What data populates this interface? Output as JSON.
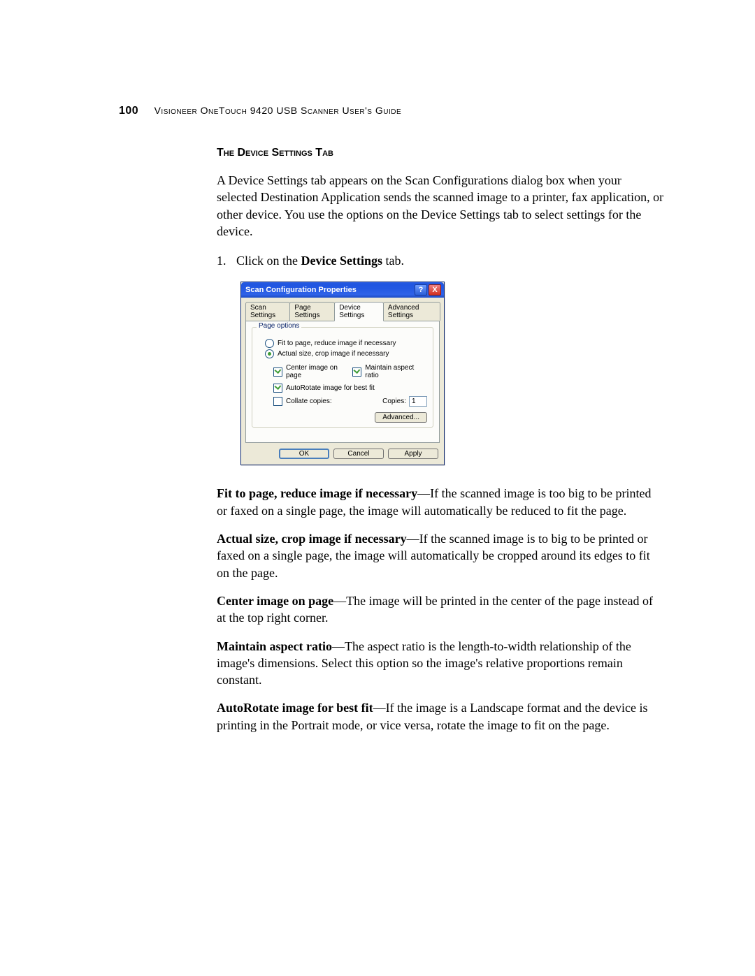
{
  "header": {
    "page_number": "100",
    "title": "Visioneer OneTouch 9420 USB Scanner User's Guide"
  },
  "section": {
    "title": "The Device Settings Tab",
    "intro": "A Device Settings tab appears on the Scan Configurations dialog box when your selected Destination Application sends the scanned image to a printer, fax application, or other device. You use the options on the Device Settings tab to select settings for the device."
  },
  "step": {
    "num": "1.",
    "pre": "Click on the ",
    "bold": "Device Settings",
    "post": " tab."
  },
  "dialog": {
    "title": "Scan Configuration Properties",
    "titlebar_help": "?",
    "titlebar_close": "X",
    "tabs": {
      "scan": "Scan Settings",
      "page": "Page Settings",
      "device": "Device Settings",
      "advanced": "Advanced Settings"
    },
    "group_title": "Page options",
    "options": {
      "fit": "Fit to page, reduce image if necessary",
      "actual": "Actual size, crop image if necessary",
      "center": "Center image on page",
      "aspect": "Maintain aspect ratio",
      "autorotate": "AutoRotate image for best fit",
      "collate": "Collate copies:",
      "copies_label": "Copies:",
      "copies_value": "1"
    },
    "buttons": {
      "advanced": "Advanced...",
      "ok": "OK",
      "cancel": "Cancel",
      "apply": "Apply"
    }
  },
  "defs": {
    "fit": {
      "term": "Fit to page, reduce image if necessary",
      "desc": "—If the scanned image is too big to be printed or faxed on a single page, the image will automatically be reduced to fit the page."
    },
    "actual": {
      "term": "Actual size, crop image if necessary",
      "desc": "—If the scanned image is to big to be printed or faxed on a single page, the image will automatically be cropped around its edges to fit on the page."
    },
    "center": {
      "term": "Center image on page",
      "desc": "—The image will be printed in the center of the page instead of at the top right corner."
    },
    "aspect": {
      "term": "Maintain aspect ratio",
      "desc": "—The aspect ratio is the length-to-width relationship of the image's dimensions. Select this option so the image's relative proportions remain constant."
    },
    "autorotate": {
      "term": "AutoRotate image for best fit",
      "desc": "—If the image is a Landscape format and the device is printing in the Portrait mode, or vice versa, rotate the image to fit on the page."
    }
  }
}
